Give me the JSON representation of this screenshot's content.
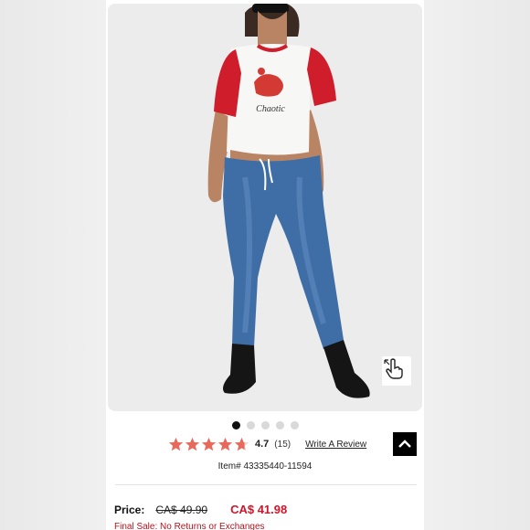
{
  "product": {
    "gallery": {
      "image_count": 5,
      "active_index": 0,
      "zoom_icon": "hand-pointer-icon"
    },
    "rating": {
      "stars": 4.7,
      "value": "4.7",
      "count": "(15)",
      "write_review": "Write A Review",
      "star_color": "#e8695b"
    },
    "item_number": "Item# 43335440-11594",
    "price": {
      "label": "Price:",
      "original": "CA$ 49.90",
      "sale": "CA$ 41.98",
      "sale_color": "#d0162b"
    },
    "final_sale_note": "Final Sale: No Returns or Exchanges",
    "graphic_text": "Chaotic",
    "back_to_top_icon": "chevron-up-icon"
  }
}
